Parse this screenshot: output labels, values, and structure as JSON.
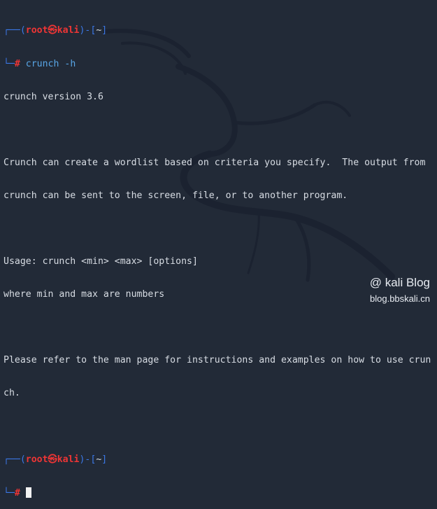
{
  "prompt": {
    "user": "root",
    "symbol": "㉿",
    "host": "kali",
    "dir": "~",
    "hash": "#"
  },
  "command": "crunch -h",
  "output_lines": [
    "crunch version 3.6",
    "",
    "Crunch can create a wordlist based on criteria you specify.  The output from",
    "crunch can be sent to the screen, file, or to another program.",
    "",
    "Usage: crunch <min> <max> [options]",
    "where min and max are numbers",
    "",
    "Please refer to the man page for instructions and examples on how to use crun",
    "ch."
  ],
  "watermark": {
    "title": "@ kali Blog",
    "url": "blog.bbskali.cn"
  },
  "colors": {
    "background": "#222a37",
    "prompt_frame": "#3b78e7",
    "prompt_user": "#ee3535",
    "command": "#58a6e7",
    "text": "#d8dde4"
  }
}
